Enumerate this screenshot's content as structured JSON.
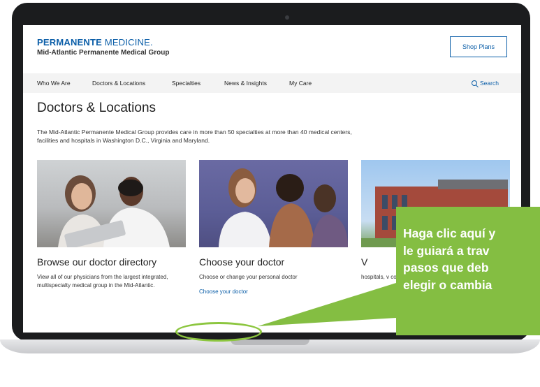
{
  "header": {
    "brand_bold": "PERMANENTE",
    "brand_light": "MEDICINE.",
    "group_name": "Mid-Atlantic Permanente Medical Group",
    "shop_button": "Shop Plans"
  },
  "nav": {
    "items": [
      "Who We Are",
      "Doctors & Locations",
      "Specialties",
      "News & Insights",
      "My Care"
    ],
    "search": "Search"
  },
  "page": {
    "title": "Doctors & Locations",
    "intro": "The Mid-Atlantic Permanente Medical Group provides care in more than 50 specialties at more than 40 medical centers, facilities and hospitals in Washington D.C., Virginia and Maryland."
  },
  "cards": [
    {
      "title": "Browse our doctor directory",
      "desc": "View all of our physicians from the largest integrated, multispecialty medical group in the Mid-Atlantic.",
      "link": ""
    },
    {
      "title": "Choose your doctor",
      "desc": "Choose or change your personal doctor",
      "link": "Choose your doctor"
    },
    {
      "title": "V",
      "desc": "hospitals, v convenient",
      "link": ""
    }
  ],
  "callout": {
    "lines": [
      "Haga clic aquí y",
      "le guiará a trav",
      "pasos que deb",
      "elegir o cambia"
    ]
  },
  "colors": {
    "brand_blue": "#0b5ea8",
    "callout_green": "#84be42",
    "ring_green": "#8cc63f"
  }
}
